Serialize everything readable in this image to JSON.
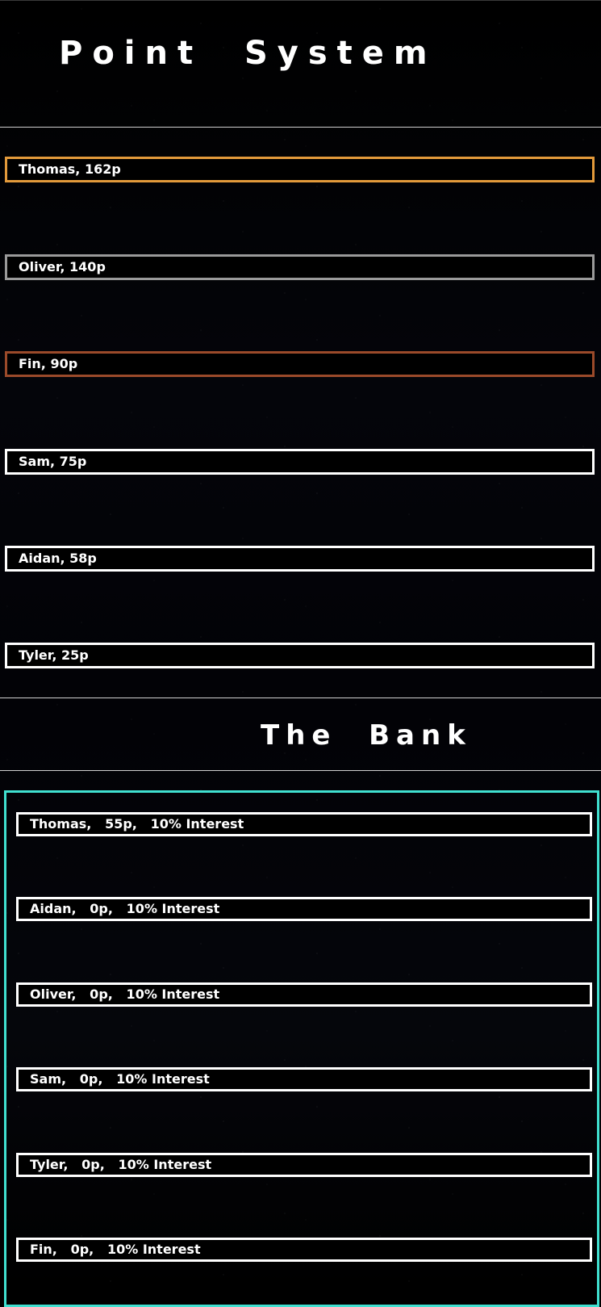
{
  "points": {
    "title": "Point  System",
    "rows": [
      {
        "label": "Thomas, 162p",
        "color": "#e39a3b"
      },
      {
        "label": "Oliver, 140p",
        "color": "#9a9a9a"
      },
      {
        "label": "Fin, 90p",
        "color": "#9b4a2a"
      },
      {
        "label": "Sam, 75p",
        "color": "#ffffff"
      },
      {
        "label": "Aidan, 58p",
        "color": "#ffffff"
      },
      {
        "label": "Tyler, 25p",
        "color": "#ffffff"
      }
    ]
  },
  "bank": {
    "title": "The  Bank",
    "panel_color": "#40e0d0",
    "rows": [
      {
        "label": "Thomas,   55p,   10% Interest"
      },
      {
        "label": "Aidan,   0p,   10% Interest"
      },
      {
        "label": "Oliver,   0p,   10% Interest"
      },
      {
        "label": "Sam,   0p,   10% Interest"
      },
      {
        "label": "Tyler,   0p,   10% Interest"
      },
      {
        "label": "Fin,   0p,   10% Interest"
      }
    ]
  }
}
